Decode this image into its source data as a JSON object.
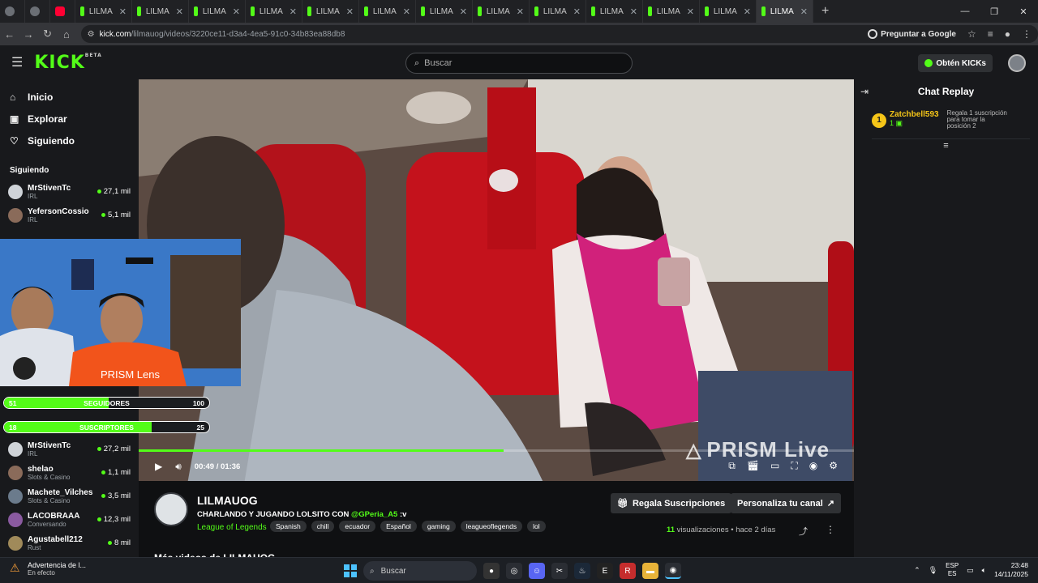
{
  "browser": {
    "tabs": [
      {
        "label": "",
        "favicon": "grey",
        "active": false
      },
      {
        "label": "",
        "favicon": "grey",
        "active": false
      },
      {
        "label": "",
        "favicon": "youtube",
        "active": false
      },
      {
        "label": "LILMA",
        "favicon": "kick",
        "active": false
      },
      {
        "label": "LILMA",
        "favicon": "kick",
        "active": false
      },
      {
        "label": "LILMA",
        "favicon": "kick",
        "active": false
      },
      {
        "label": "LILMA",
        "favicon": "kick",
        "active": false
      },
      {
        "label": "LILMA",
        "favicon": "kick",
        "active": false
      },
      {
        "label": "LILMA",
        "favicon": "kick",
        "active": false
      },
      {
        "label": "LILMA",
        "favicon": "kick",
        "active": false
      },
      {
        "label": "LILMA",
        "favicon": "kick",
        "active": false
      },
      {
        "label": "LILMA",
        "favicon": "kick",
        "active": false
      },
      {
        "label": "LILMA",
        "favicon": "kick",
        "active": false
      },
      {
        "label": "LILMA",
        "favicon": "kick",
        "active": false
      },
      {
        "label": "LILMA",
        "favicon": "kick",
        "active": false
      },
      {
        "label": "LILMA",
        "favicon": "kick",
        "active": true
      }
    ],
    "url_host": "kick.com",
    "url_path": "/lilmauog/videos/3220ce11-d3a4-4ea5-91c0-34b83ea88db8",
    "ask_google": "Preguntar a Google"
  },
  "header": {
    "logo": "KICK",
    "logo_badge": "BETA",
    "search_placeholder": "Buscar",
    "kicks_button": "Obtén KICKs"
  },
  "sidebar": {
    "nav": [
      {
        "label": "Inicio",
        "icon": "home-icon"
      },
      {
        "label": "Explorar",
        "icon": "explore-icon"
      },
      {
        "label": "Siguiendo",
        "icon": "heart-icon"
      }
    ],
    "section_title": "Siguiendo",
    "channels_top": [
      {
        "name": "MrStivenTc",
        "category": "IRL",
        "viewers": "27,1 mil"
      },
      {
        "name": "YefersonCossio",
        "category": "IRL",
        "viewers": "5,1 mil"
      }
    ],
    "channels_bottom": [
      {
        "name": "MrStivenTc",
        "category": "IRL",
        "viewers": "27,2 mil"
      },
      {
        "name": "shelao",
        "category": "Slots & Casino",
        "viewers": "1,1 mil"
      },
      {
        "name": "Machete_Vilches",
        "category": "Slots & Casino",
        "viewers": "3,5 mil"
      },
      {
        "name": "LACOBRAAA",
        "category": "Conversando",
        "viewers": "12,3 mil"
      },
      {
        "name": "Agustabell212",
        "category": "Rust",
        "viewers": "8 mil"
      }
    ]
  },
  "overlay": {
    "cam_label": "PRISM Lens",
    "followers": {
      "left": "51",
      "label": "SEGUIDORES",
      "right": "100",
      "progress": 0.51
    },
    "subs": {
      "left": "18",
      "label": "SUSCRIPTORES",
      "right": "25",
      "progress": 0.72
    }
  },
  "player": {
    "watermark": "PRISM Live",
    "time_current": "00:49",
    "time_total": "01:36",
    "progress": 0.51
  },
  "chat": {
    "title": "Chat Replay",
    "top_gifter": {
      "rank": "1",
      "user": "Zatchbell593",
      "count": "1",
      "text": "Regala 1 suscripción para tomar la posición 2"
    }
  },
  "video_info": {
    "streamer": "LILMAUOG",
    "title_prefix": "CHARLANDO Y JUGANDO LOLSITO CON ",
    "title_mention": "@GPeria_A5",
    "title_suffix": " :v",
    "category": "League of Legends",
    "tags": [
      "Spanish",
      "chill",
      "ecuador",
      "Español",
      "gaming",
      "leagueoflegends",
      "lol"
    ],
    "gift_button": "Regala Suscripciones",
    "customize_button": "Personaliza tu canal",
    "views_count": "11",
    "views_label": " visualizaciones",
    "time_ago": "hace 2 días",
    "more_videos": "Más videos de LILMAUOG"
  },
  "taskbar": {
    "weather_title": "Advertencia de l...",
    "weather_sub": "En efecto",
    "search": "Buscar",
    "lang_top": "ESP",
    "lang_bottom": "ES",
    "time": "23:48",
    "date": "14/11/2025"
  }
}
